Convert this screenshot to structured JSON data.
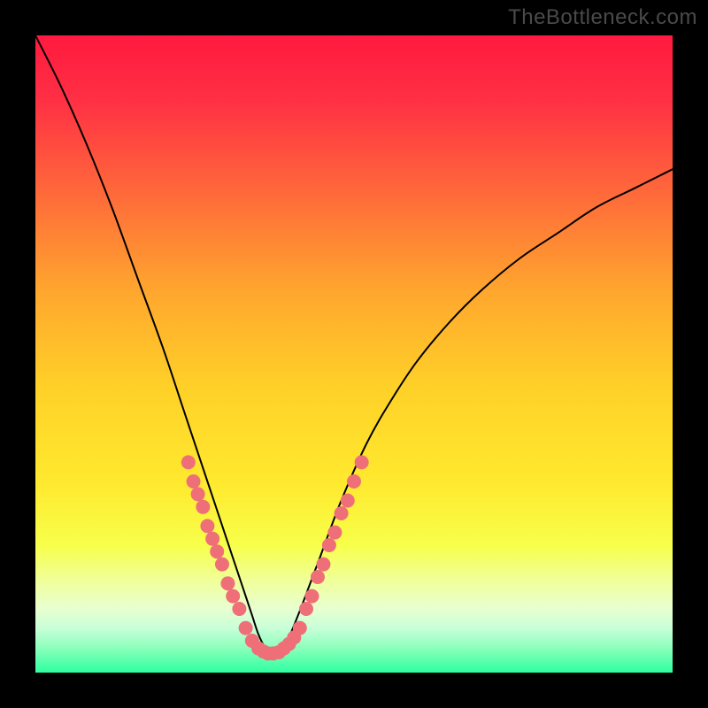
{
  "watermark": "TheBottleneck.com",
  "chart_data": {
    "type": "line",
    "title": "",
    "xlabel": "",
    "ylabel": "",
    "xlim": [
      0,
      100
    ],
    "ylim": [
      0,
      100
    ],
    "background_gradient": {
      "stops": [
        {
          "offset": 0.0,
          "color": "#ff1a3f"
        },
        {
          "offset": 0.1,
          "color": "#ff2f44"
        },
        {
          "offset": 0.25,
          "color": "#ff6a3a"
        },
        {
          "offset": 0.4,
          "color": "#ffa62e"
        },
        {
          "offset": 0.55,
          "color": "#ffd028"
        },
        {
          "offset": 0.7,
          "color": "#ffe92e"
        },
        {
          "offset": 0.8,
          "color": "#f7ff4a"
        },
        {
          "offset": 0.86,
          "color": "#efffa0"
        },
        {
          "offset": 0.9,
          "color": "#e8ffd0"
        },
        {
          "offset": 0.93,
          "color": "#c8ffd8"
        },
        {
          "offset": 0.96,
          "color": "#8effbd"
        },
        {
          "offset": 1.0,
          "color": "#2dffa0"
        }
      ]
    },
    "series": [
      {
        "name": "curve",
        "color": "#000000",
        "width": 2,
        "x": [
          0,
          4,
          8,
          12,
          16,
          20,
          23,
          25,
          27,
          29,
          31,
          33,
          34,
          35,
          36,
          37,
          38,
          39,
          40,
          42,
          45,
          48,
          52,
          56,
          60,
          65,
          70,
          76,
          82,
          88,
          94,
          100
        ],
        "y": [
          100,
          92,
          83,
          73,
          62,
          51,
          42,
          36,
          30,
          24,
          18,
          12,
          9,
          6,
          4,
          3,
          3,
          4,
          6,
          11,
          19,
          27,
          36,
          43,
          49,
          55,
          60,
          65,
          69,
          73,
          76,
          79
        ]
      }
    ],
    "marker_groups": [
      {
        "name": "left-branch-markers",
        "color": "#ef6f78",
        "radius": 8,
        "points": [
          {
            "x": 24.0,
            "y": 33
          },
          {
            "x": 24.8,
            "y": 30
          },
          {
            "x": 25.5,
            "y": 28
          },
          {
            "x": 26.3,
            "y": 26
          },
          {
            "x": 27.0,
            "y": 23
          },
          {
            "x": 27.8,
            "y": 21
          },
          {
            "x": 28.5,
            "y": 19
          },
          {
            "x": 29.3,
            "y": 17
          },
          {
            "x": 30.2,
            "y": 14
          },
          {
            "x": 31.0,
            "y": 12
          },
          {
            "x": 32.0,
            "y": 10
          },
          {
            "x": 33.0,
            "y": 7
          },
          {
            "x": 34.0,
            "y": 5
          }
        ]
      },
      {
        "name": "valley-markers",
        "color": "#ef6f78",
        "radius": 8,
        "points": [
          {
            "x": 35.0,
            "y": 3.8
          },
          {
            "x": 35.8,
            "y": 3.3
          },
          {
            "x": 36.5,
            "y": 3.0
          },
          {
            "x": 37.3,
            "y": 3.0
          },
          {
            "x": 38.2,
            "y": 3.2
          },
          {
            "x": 39.0,
            "y": 3.8
          },
          {
            "x": 39.8,
            "y": 4.5
          },
          {
            "x": 40.6,
            "y": 5.5
          }
        ]
      },
      {
        "name": "right-branch-markers",
        "color": "#ef6f78",
        "radius": 8,
        "points": [
          {
            "x": 41.5,
            "y": 7
          },
          {
            "x": 42.5,
            "y": 10
          },
          {
            "x": 43.4,
            "y": 12
          },
          {
            "x": 44.3,
            "y": 15
          },
          {
            "x": 45.2,
            "y": 17
          },
          {
            "x": 46.1,
            "y": 20
          },
          {
            "x": 47.0,
            "y": 22
          },
          {
            "x": 48.0,
            "y": 25
          },
          {
            "x": 49.0,
            "y": 27
          },
          {
            "x": 50.0,
            "y": 30
          },
          {
            "x": 51.2,
            "y": 33
          }
        ]
      }
    ]
  }
}
